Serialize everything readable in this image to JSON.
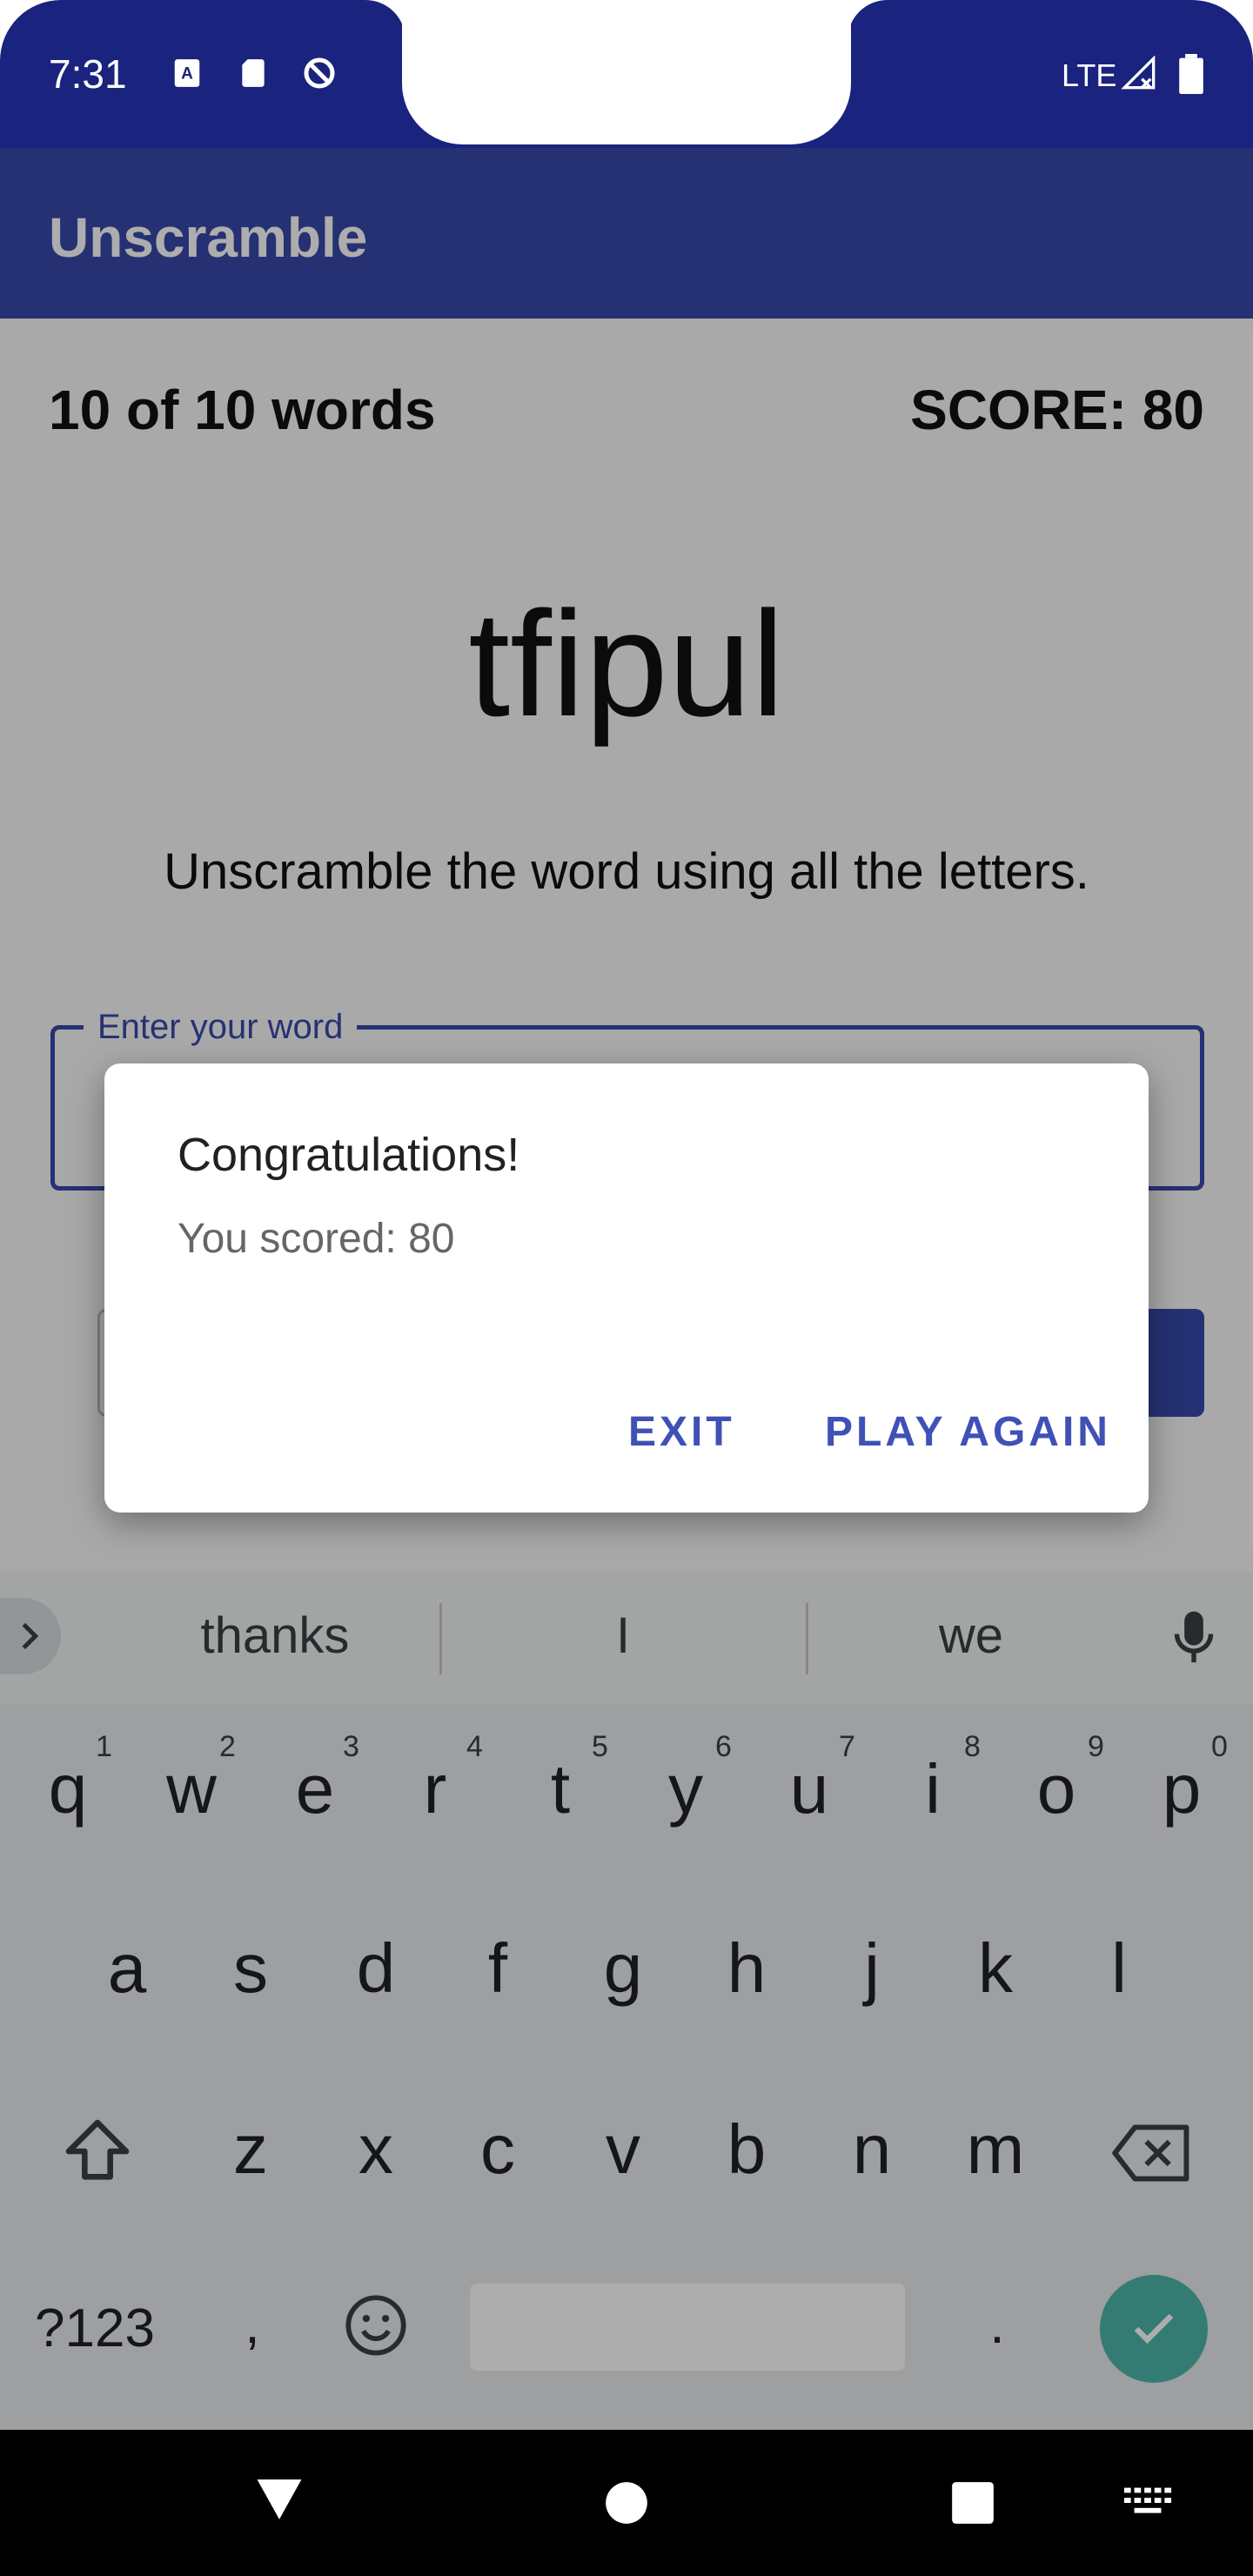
{
  "status_bar": {
    "time": "7:31",
    "network": "LTE"
  },
  "app_bar": {
    "title": "Unscramble"
  },
  "game": {
    "word_count": "10 of 10 words",
    "score": "SCORE: 80",
    "scrambled_word": "tfipul",
    "instructions": "Unscramble the word using all the letters.",
    "input_label": "Enter your word",
    "input_value": ""
  },
  "dialog": {
    "title": "Congratulations!",
    "message": "You scored: 80",
    "exit_label": "EXIT",
    "play_again_label": "PLAY AGAIN"
  },
  "keyboard": {
    "suggestions": [
      "thanks",
      "I",
      "we"
    ],
    "row1": [
      "q",
      "w",
      "e",
      "r",
      "t",
      "y",
      "u",
      "i",
      "o",
      "p"
    ],
    "row1_hints": [
      "1",
      "2",
      "3",
      "4",
      "5",
      "6",
      "7",
      "8",
      "9",
      "0"
    ],
    "row2": [
      "a",
      "s",
      "d",
      "f",
      "g",
      "h",
      "j",
      "k",
      "l"
    ],
    "row3": [
      "z",
      "x",
      "c",
      "v",
      "b",
      "n",
      "m"
    ],
    "symbols_label": "?123",
    "comma": ",",
    "period": "."
  },
  "colors": {
    "primary": "#3949ab",
    "status_bar": "#1a237e",
    "accent": "#3f51b5",
    "enter_key": "#4db6ac"
  }
}
